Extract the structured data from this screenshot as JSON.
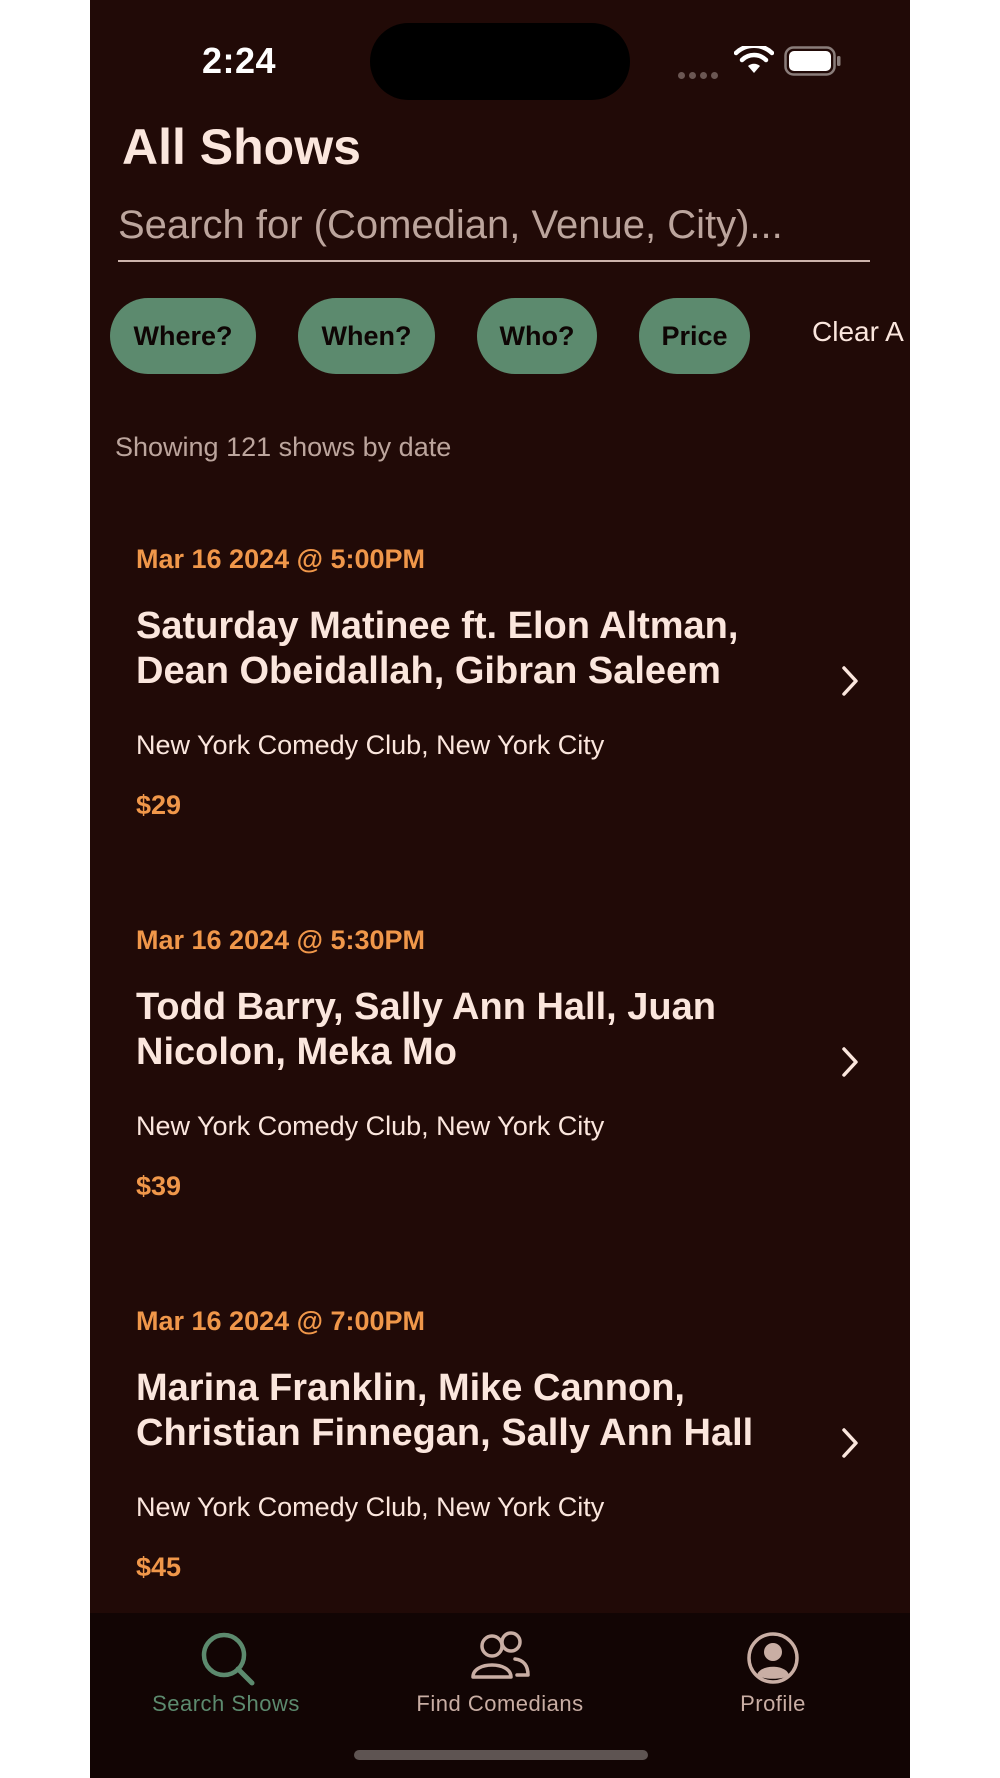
{
  "status_bar": {
    "time": "2:24"
  },
  "header": {
    "title": "All Shows",
    "search_placeholder": "Search for (Comedian, Venue, City)..."
  },
  "filters": {
    "chips": [
      "Where?",
      "When?",
      "Who?",
      "Price"
    ],
    "clear_label": "Clear A"
  },
  "summary": "Showing 121 shows by date",
  "shows": [
    {
      "datetime": "Mar 16 2024 @ 5:00PM",
      "name": "Saturday Matinee ft. Elon Altman, Dean Obeidallah, Gibran Saleem",
      "venue": "New York Comedy Club, New York City",
      "price": "$29"
    },
    {
      "datetime": "Mar 16 2024 @ 5:30PM",
      "name": "Todd Barry, Sally Ann Hall, Juan Nicolon, Meka Mo",
      "venue": "New York Comedy Club, New York City",
      "price": "$39"
    },
    {
      "datetime": "Mar 16 2024 @ 7:00PM",
      "name": "Marina Franklin, Mike Cannon, Christian Finnegan, Sally Ann Hall",
      "venue": "New York Comedy Club, New York City",
      "price": "$45"
    }
  ],
  "tab_bar": {
    "tabs": [
      {
        "label": "Search Shows",
        "icon": "search-icon",
        "active": true
      },
      {
        "label": "Find Comedians",
        "icon": "people-icon",
        "active": false
      },
      {
        "label": "Profile",
        "icon": "profile-icon",
        "active": false
      }
    ]
  },
  "colors": {
    "background": "#210a07",
    "accent_green": "#5c8a6e",
    "accent_orange": "#f0974a",
    "text_primary": "#fbe6dd",
    "tab_inactive": "#c9aea4"
  }
}
